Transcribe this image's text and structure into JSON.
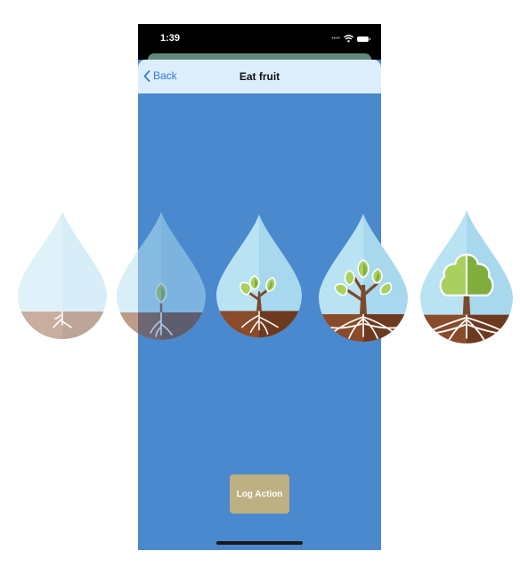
{
  "status_bar": {
    "time": "1:39",
    "icons": [
      "cellular-dots-icon",
      "wifi-icon",
      "battery-icon"
    ]
  },
  "nav": {
    "back_label": "Back",
    "title": "Eat fruit"
  },
  "growth_stages": [
    {
      "name": "seed-roots",
      "faded": true
    },
    {
      "name": "sprout",
      "faded": true
    },
    {
      "name": "sapling",
      "faded": false
    },
    {
      "name": "young-tree",
      "faded": false
    },
    {
      "name": "full-tree",
      "faded": false
    }
  ],
  "action": {
    "log_label": "Log Action"
  },
  "colors": {
    "phone_background": "#4a89cd",
    "nav_background": "#dceefb",
    "button_background": "#bdb083",
    "back_link": "#2f7ad6",
    "drop_sky_light": "#b9e3f3",
    "drop_sky_dark": "#a7d8ee",
    "soil_light": "#8a4b2a",
    "soil_dark": "#6e3a1f",
    "leaf_light": "#a9cf5e",
    "leaf_dark": "#7fae3f"
  }
}
